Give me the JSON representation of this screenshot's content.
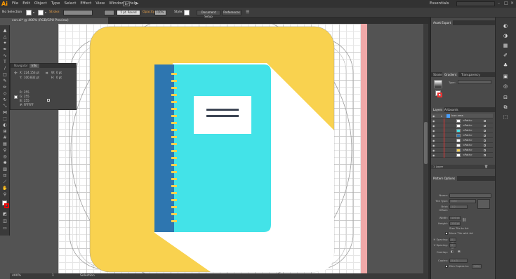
{
  "app": {
    "logo": "Ai",
    "workspace": "Essentials",
    "window_buttons": [
      "–",
      "□",
      "×"
    ]
  },
  "menu": [
    "File",
    "Edit",
    "Object",
    "Type",
    "Select",
    "Effect",
    "View",
    "Window",
    "Help"
  ],
  "menu_badge": "Br",
  "control_bar": {
    "selection_text": "No Selection",
    "stroke_label": "Stroke:",
    "brush_label": "5 pt. Round",
    "opacity_label": "Opacity:",
    "opacity_value": "100%",
    "style_label": "Style:",
    "document_setup": "Document Setup",
    "preferences": "Preferences"
  },
  "document": {
    "tab_title": "con.ai* @ 400% (RGB/GPU Preview)"
  },
  "info_panel": {
    "tabs": [
      "Navigator",
      "Info"
    ],
    "x_label": "X:",
    "x_value": "224.153 pt",
    "y_label": "Y:",
    "y_value": "100.832 pt",
    "w_label": "W:",
    "w_value": "0 pt",
    "h_label": "H:",
    "h_value": "0 pt",
    "r_label": "R:",
    "r_value": "255",
    "g_label": "G:",
    "g_value": "255",
    "b_label": "B:",
    "b_value": "255",
    "hex_label": "#:",
    "hex_value": "FFFFFF"
  },
  "right_panels": {
    "asset_export": "Asset Export",
    "stroke_tabs": [
      "Stroke",
      "Gradient",
      "Transparency"
    ],
    "gradient_type_label": "Type:",
    "layers_tabs": [
      "Layers",
      "Artboards"
    ],
    "layer_top_name": "Icon area",
    "layer_item_name": "<Path>",
    "layers_count": "1 Layer",
    "pattern_title": "Pattern Options",
    "pattern_fields": [
      {
        "label": "Name:",
        "value": ""
      },
      {
        "label": "Tile Type:",
        "value": "Grid"
      },
      {
        "label": "Brick Offset:",
        "value": "1/2"
      },
      {
        "label": "Width:",
        "value": "100 pt"
      },
      {
        "label": "Height:",
        "value": "100 pt"
      },
      {
        "label": "",
        "value": "Size Tile to Art"
      },
      {
        "label": "",
        "value": "Move Tile with Art"
      },
      {
        "label": "H Spacing:",
        "value": "0 pt"
      },
      {
        "label": "V Spacing:",
        "value": "0 pt"
      },
      {
        "label": "Overlap:",
        "value": ""
      },
      {
        "label": "Copies:",
        "value": "5 x 5"
      },
      {
        "label": "",
        "value": "Dim Copies to:"
      }
    ],
    "dim_value": "70%"
  },
  "status": {
    "zoom": "400%",
    "page": "1",
    "mode": "Selection"
  },
  "colors": {
    "icon_yellow": "#F9D24F",
    "notebook_cyan": "#43E3E8",
    "notebook_spine": "#2E76B0",
    "label_lines": "#3D4655",
    "bleed": "#F0A8A8"
  }
}
